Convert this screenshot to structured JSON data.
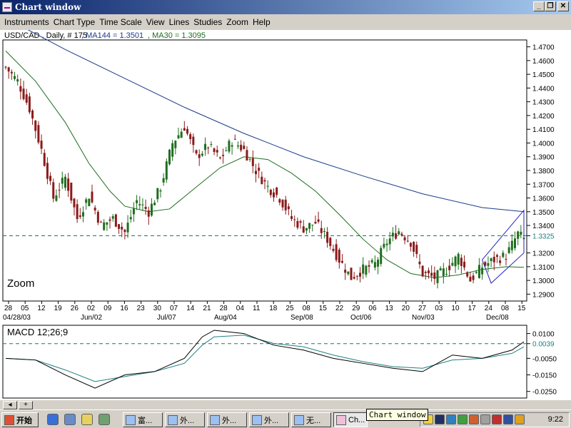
{
  "window": {
    "title": "Chart window",
    "buttons": {
      "minimize": "_",
      "maximize": "❐",
      "close": "✕"
    }
  },
  "menu": [
    "Instruments",
    "Chart Type",
    "Time Scale",
    "View",
    "Lines",
    "Studies",
    "Zoom",
    "Help"
  ],
  "header": {
    "symbol": "USD/CAD , Daily, # 175",
    "ma144": ", MA144 = 1.3501",
    "ma30": ", MA30 = 1.3095"
  },
  "price_panel": {
    "zoom_label": "Zoom",
    "price_ticks": [
      "1.4700",
      "1.4600",
      "1.4500",
      "1.4400",
      "1.4300",
      "1.4200",
      "1.4100",
      "1.4000",
      "1.3900",
      "1.3800",
      "1.3700",
      "1.3600",
      "1.3500",
      "1.3400",
      "1.3325",
      "1.3200",
      "1.3100",
      "1.3000",
      "1.2900"
    ],
    "highlight_tick": "1.3325",
    "date_ticks": [
      "28",
      "05",
      "12",
      "19",
      "26",
      "02",
      "09",
      "16",
      "23",
      "30",
      "07",
      "14",
      "21",
      "28",
      "04",
      "11",
      "18",
      "25",
      "08",
      "15",
      "22",
      "29",
      "06",
      "13",
      "20",
      "27",
      "03",
      "10",
      "17",
      "24",
      "08",
      "15"
    ],
    "month_labels": [
      "04/28/03",
      "Jun/02",
      "Jul/07",
      "Aug/04",
      "Sep/08",
      "Oct/06",
      "Nov/03",
      "Dec/08"
    ]
  },
  "macd_panel": {
    "label": "MACD 12;26;9",
    "ticks": [
      "0.0100",
      "0.0039",
      "-0.0050",
      "-0.0150",
      "-0.0250"
    ],
    "highlight_tick": "0.0039"
  },
  "colors": {
    "ma144": "#1a3a8a",
    "ma30": "#1e6e1e",
    "candle_up": "#1e6e1e",
    "candle_down": "#8b1a1a",
    "dashed": "#207070",
    "macd": "#000000",
    "signal": "#208080",
    "channel": "#2020c0"
  },
  "chart_data": [
    {
      "type": "candlestick",
      "title": "USD/CAD , Daily, # 175",
      "series": [
        {
          "name": "MA144 = 1.3501",
          "x": [
            0,
            20,
            40,
            60,
            80,
            100,
            120,
            140,
            160,
            174
          ],
          "values": [
            1.491,
            1.468,
            1.447,
            1.426,
            1.407,
            1.39,
            1.376,
            1.363,
            1.353,
            1.35
          ]
        },
        {
          "name": "MA30 = 1.3095",
          "x": [
            0,
            10,
            20,
            28,
            35,
            40,
            48,
            55,
            64,
            72,
            80,
            88,
            96,
            104,
            112,
            120,
            128,
            136,
            144,
            152,
            160,
            168,
            174
          ],
          "values": [
            1.467,
            1.445,
            1.415,
            1.385,
            1.365,
            1.354,
            1.35,
            1.352,
            1.368,
            1.382,
            1.39,
            1.388,
            1.378,
            1.365,
            1.348,
            1.33,
            1.315,
            1.305,
            1.302,
            1.304,
            1.308,
            1.31,
            1.3095
          ]
        },
        {
          "name": "Close",
          "x": [
            0,
            4,
            8,
            12,
            16,
            20,
            24,
            28,
            32,
            36,
            40,
            44,
            48,
            52,
            56,
            60,
            64,
            68,
            72,
            76,
            80,
            84,
            88,
            92,
            96,
            100,
            104,
            108,
            112,
            116,
            120,
            124,
            128,
            132,
            136,
            140,
            144,
            148,
            152,
            156,
            160,
            164,
            168,
            172,
            174
          ],
          "values": [
            1.455,
            1.445,
            1.425,
            1.395,
            1.36,
            1.375,
            1.345,
            1.362,
            1.34,
            1.345,
            1.335,
            1.358,
            1.35,
            1.368,
            1.4,
            1.412,
            1.39,
            1.398,
            1.388,
            1.402,
            1.395,
            1.38,
            1.368,
            1.36,
            1.345,
            1.338,
            1.342,
            1.33,
            1.315,
            1.302,
            1.308,
            1.312,
            1.328,
            1.336,
            1.328,
            1.305,
            1.302,
            1.308,
            1.318,
            1.3,
            1.31,
            1.315,
            1.318,
            1.334,
            1.33
          ]
        }
      ],
      "ylim": [
        1.285,
        1.475
      ],
      "grid": false
    },
    {
      "type": "line",
      "title": "MACD 12;26;9",
      "series": [
        {
          "name": "MACD",
          "x": [
            0,
            10,
            20,
            30,
            40,
            50,
            60,
            66,
            70,
            80,
            90,
            100,
            110,
            120,
            130,
            140,
            150,
            160,
            170,
            174
          ],
          "values": [
            -0.005,
            -0.006,
            -0.015,
            -0.023,
            -0.015,
            -0.013,
            -0.005,
            0.008,
            0.012,
            0.01,
            0.003,
            0.0,
            -0.005,
            -0.008,
            -0.011,
            -0.013,
            -0.003,
            -0.005,
            0.0,
            0.005
          ]
        },
        {
          "name": "Signal",
          "x": [
            0,
            10,
            20,
            30,
            40,
            50,
            60,
            66,
            70,
            80,
            90,
            100,
            110,
            120,
            130,
            140,
            150,
            160,
            170,
            174
          ],
          "values": [
            -0.005,
            -0.006,
            -0.012,
            -0.019,
            -0.016,
            -0.013,
            -0.008,
            0.003,
            0.008,
            0.009,
            0.004,
            0.002,
            -0.003,
            -0.007,
            -0.01,
            -0.011,
            -0.006,
            -0.005,
            -0.002,
            0.002
          ]
        }
      ],
      "ylim": [
        -0.029,
        0.015
      ],
      "grid": false
    }
  ],
  "taskbar": {
    "start": "开始",
    "tasks": [
      "富...",
      "外...",
      "外...",
      "外...",
      "无...",
      "Ch..."
    ],
    "tooltip": "Chart window",
    "clock": "9:22"
  }
}
